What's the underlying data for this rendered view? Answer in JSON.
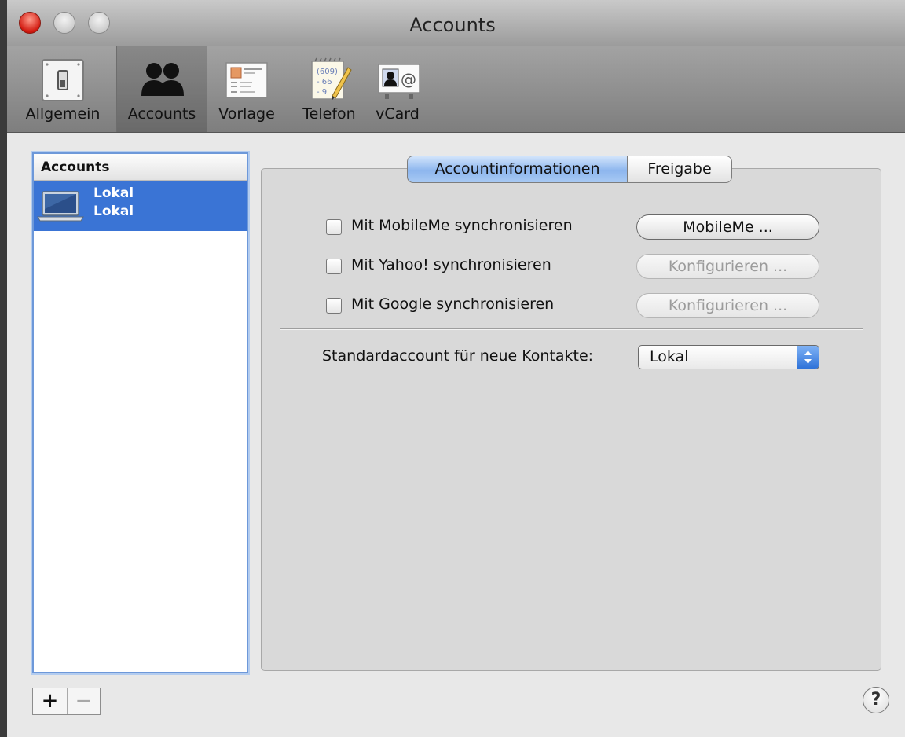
{
  "window": {
    "title": "Accounts"
  },
  "toolbar": {
    "items": [
      {
        "label": "Allgemein",
        "icon": "switch-icon",
        "selected": false
      },
      {
        "label": "Accounts",
        "icon": "people-icon",
        "selected": true
      },
      {
        "label": "Vorlage",
        "icon": "card-template-icon",
        "selected": false
      },
      {
        "label": "Telefon",
        "icon": "phone-notepad-icon",
        "selected": false
      },
      {
        "label": "vCard",
        "icon": "vcard-icon",
        "selected": false
      }
    ]
  },
  "accounts_list": {
    "header": "Accounts",
    "items": [
      {
        "name": "Lokal",
        "subtitle": "Lokal",
        "icon": "laptop-icon",
        "selected": true
      }
    ],
    "add_label": "+",
    "remove_label": "−"
  },
  "tabs": {
    "items": [
      {
        "label": "Accountinformationen",
        "active": true
      },
      {
        "label": "Freigabe",
        "active": false
      }
    ]
  },
  "sync": {
    "rows": [
      {
        "label": "Mit MobileMe synchronisieren",
        "checked": false,
        "button": "MobileMe ...",
        "button_enabled": true
      },
      {
        "label": "Mit Yahoo! synchronisieren",
        "checked": false,
        "button": "Konfigurieren ...",
        "button_enabled": false
      },
      {
        "label": "Mit Google synchronisieren",
        "checked": false,
        "button": "Konfigurieren ...",
        "button_enabled": false
      }
    ]
  },
  "default_account": {
    "label": "Standardaccount für neue Kontakte:",
    "value": "Lokal"
  },
  "help": {
    "label": "?"
  },
  "colors": {
    "selection": "#3a74d5",
    "close_button": "#d21a10",
    "focus_ring": "#6d98d9"
  }
}
